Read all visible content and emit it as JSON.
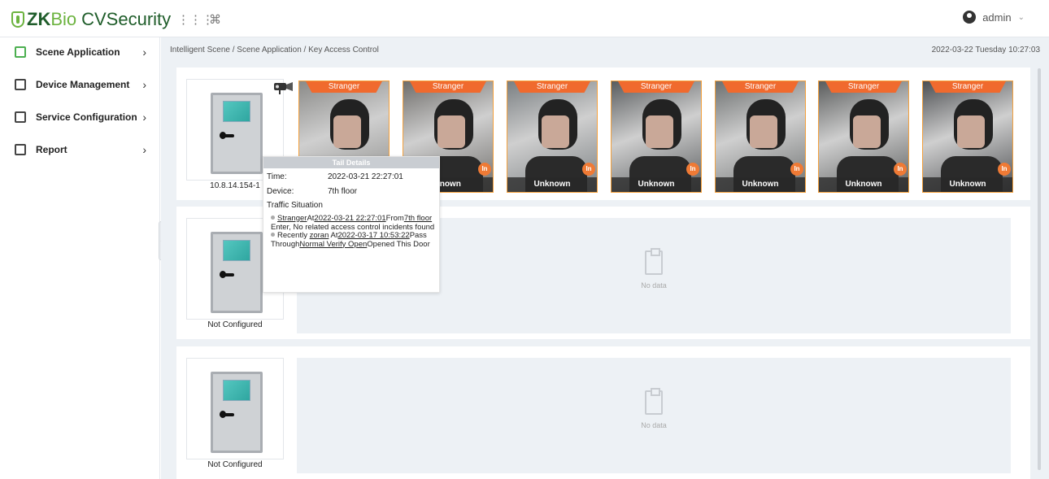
{
  "header": {
    "logo_zk": "ZK",
    "logo_bio": "Bio",
    "logo_cvs": "CVSecurity",
    "apps_icon": "grid-icon",
    "cmd_icon": "command-icon",
    "user_name": "admin"
  },
  "sidebar": {
    "items": [
      {
        "label": "Scene Application",
        "icon": "scene-icon"
      },
      {
        "label": "Device Management",
        "icon": "device-icon"
      },
      {
        "label": "Service Configuration",
        "icon": "service-icon"
      },
      {
        "label": "Report",
        "icon": "report-icon"
      }
    ],
    "collapse_glyph": "«"
  },
  "main": {
    "breadcrumb": "Intelligent Scene / Scene Application / Key Access Control",
    "datetime": "2022-03-22 Tuesday 10:27:03",
    "panels": [
      {
        "door_label": "10.8.14.154-1",
        "snapshots": [
          {
            "tag": "Stranger",
            "name": "",
            "dir": ""
          },
          {
            "tag": "Stranger",
            "name": "known",
            "dir": "In"
          },
          {
            "tag": "Stranger",
            "name": "Unknown",
            "dir": "In"
          },
          {
            "tag": "Stranger",
            "name": "Unknown",
            "dir": "In"
          },
          {
            "tag": "Stranger",
            "name": "Unknown",
            "dir": "In"
          },
          {
            "tag": "Stranger",
            "name": "Unknown",
            "dir": "In"
          },
          {
            "tag": "Stranger",
            "name": "Unknown",
            "dir": "In"
          }
        ]
      },
      {
        "door_label": "Not Configured",
        "no_data": "No data"
      },
      {
        "door_label": "Not Configured",
        "no_data": "No data"
      }
    ]
  },
  "tooltip": {
    "title": "Tail Details",
    "time_label": "Time:",
    "time_value": "2022-03-21 22:27:01",
    "device_label": "Device:",
    "device_value": "7th floor",
    "section": "Traffic Situation",
    "line1": {
      "who": "Stranger",
      "at": "At",
      "when": "2022-03-21 22:27:01",
      "from": "From",
      "where": "7th floor",
      "rest": " Enter,  No related access control incidents found"
    },
    "line2": {
      "pre": "Recently ",
      "who": "zoran",
      "at": " At",
      "when": "2022-03-17 10:53:22",
      "mid": "Pass Through",
      "mode": "Normal Verify Open",
      "rest": "Opened This Door"
    }
  },
  "colors": {
    "accent": "#6cb33f",
    "brand_dark": "#1f5d2a",
    "stranger_tag": "#f06a2e",
    "snap_border": "#f4a13d",
    "background": "#edf1f5"
  }
}
